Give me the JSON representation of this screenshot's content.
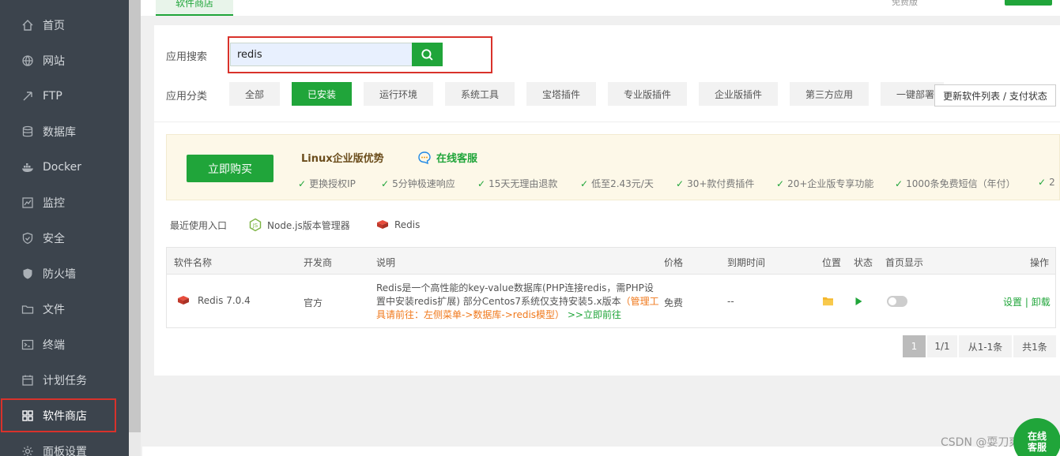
{
  "sidebar": {
    "items": [
      {
        "label": "首页",
        "icon": "home-icon"
      },
      {
        "label": "网站",
        "icon": "globe-icon"
      },
      {
        "label": "FTP",
        "icon": "ftp-icon"
      },
      {
        "label": "数据库",
        "icon": "database-icon"
      },
      {
        "label": "Docker",
        "icon": "docker-icon"
      },
      {
        "label": "监控",
        "icon": "monitor-icon"
      },
      {
        "label": "安全",
        "icon": "shield-icon"
      },
      {
        "label": "防火墙",
        "icon": "firewall-icon"
      },
      {
        "label": "文件",
        "icon": "folder-icon"
      },
      {
        "label": "终端",
        "icon": "terminal-icon"
      },
      {
        "label": "计划任务",
        "icon": "calendar-icon"
      },
      {
        "label": "软件商店",
        "icon": "grid-icon"
      },
      {
        "label": "面板设置",
        "icon": "gear-icon"
      }
    ],
    "active": "软件商店"
  },
  "header": {
    "tab_label": "软件商店",
    "right_text": "免费版"
  },
  "search": {
    "label": "应用搜索",
    "value": "redis"
  },
  "categories": {
    "label": "应用分类",
    "items": [
      "全部",
      "已安装",
      "运行环境",
      "系统工具",
      "宝塔插件",
      "专业版插件",
      "企业版插件",
      "第三方应用",
      "一键部署"
    ],
    "active": "已安装",
    "update_button": "更新软件列表 / 支付状态"
  },
  "promo": {
    "buy_button": "立即购买",
    "title": "Linux企业版优势",
    "service": "在线客服",
    "features": [
      "更换授权IP",
      "5分钟极速响应",
      "15天无理由退款",
      "低至2.43元/天",
      "30+款付费插件",
      "20+企业版专享功能",
      "1000条免费短信（年付）",
      "2"
    ]
  },
  "recent": {
    "label": "最近使用入口",
    "items": [
      "Node.js版本管理器",
      "Redis"
    ]
  },
  "table": {
    "headers": [
      "软件名称",
      "开发商",
      "说明",
      "价格",
      "到期时间",
      "位置",
      "状态",
      "首页显示",
      "操作"
    ],
    "rows": [
      {
        "name": "Redis 7.0.4",
        "developer": "官方",
        "desc_main": "Redis是一个高性能的key-value数据库(PHP连接redis，需PHP设置中安装redis扩展) 部分Centos7系统仅支持安装5.x版本",
        "desc_warn": "（管理工具请前往：左侧菜单->数据库->redis模型）",
        "desc_link": ">>立即前往",
        "price": "免费",
        "expire": "--",
        "op_settings": "设置",
        "op_sep": "|",
        "op_uninstall": "卸载"
      }
    ]
  },
  "pagination": {
    "current": "1",
    "total_pages": "1/1",
    "range": "从1-1条",
    "total": "共1条"
  },
  "watermark": "CSDN @耍刀爽",
  "chat": {
    "line1": "在线",
    "line2": "客服"
  },
  "colors": {
    "accent": "#20a53a",
    "sidebar": "#3c444d",
    "highlight": "#d9322b",
    "warn": "#f0791c"
  }
}
